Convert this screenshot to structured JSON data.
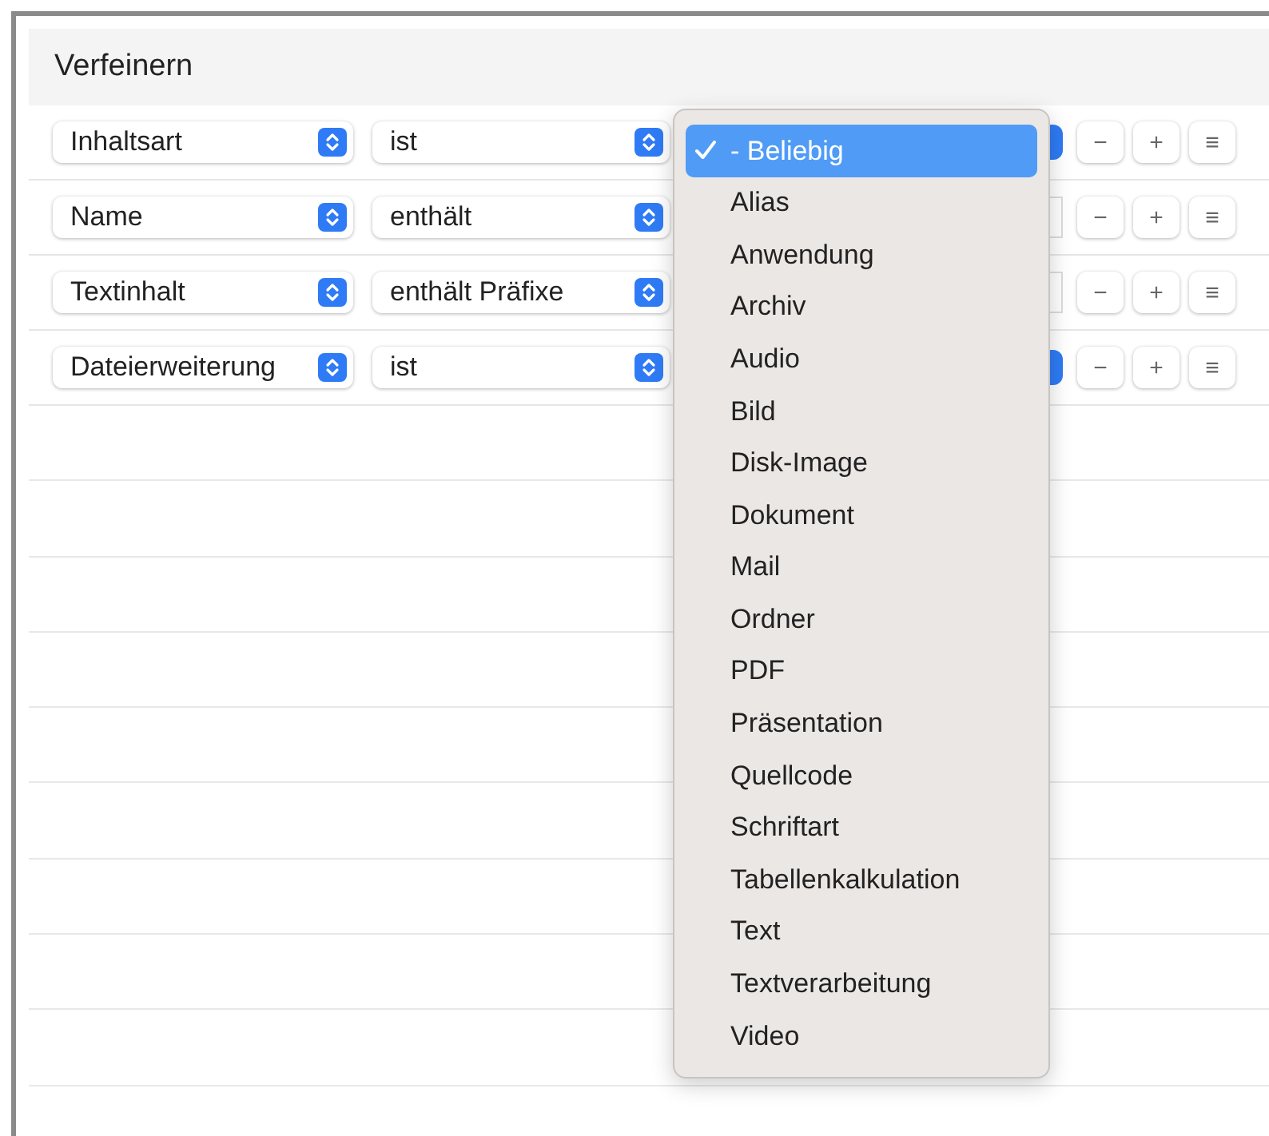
{
  "title": "Verfeinern",
  "rows": [
    {
      "attribute": "Inhaltsart",
      "operator": "ist",
      "kind": "popup"
    },
    {
      "attribute": "Name",
      "operator": "enthält",
      "kind": "field"
    },
    {
      "attribute": "Textinhalt",
      "operator": "enthält Präfixe",
      "kind": "field"
    },
    {
      "attribute": "Dateierweiterung",
      "operator": "ist",
      "kind": "popup"
    }
  ],
  "row_buttons": [
    "−",
    "+",
    "≡"
  ],
  "menu": [
    {
      "label": "- Beliebig",
      "selected": true
    },
    {
      "label": "Alias",
      "selected": false
    },
    {
      "label": "Anwendung",
      "selected": false
    },
    {
      "label": "Archiv",
      "selected": false
    },
    {
      "label": "Audio",
      "selected": false
    },
    {
      "label": "Bild",
      "selected": false
    },
    {
      "label": "Disk-Image",
      "selected": false
    },
    {
      "label": "Dokument",
      "selected": false
    },
    {
      "label": "Mail",
      "selected": false
    },
    {
      "label": "Ordner",
      "selected": false
    },
    {
      "label": "PDF",
      "selected": false
    },
    {
      "label": "Präsentation",
      "selected": false
    },
    {
      "label": "Quellcode",
      "selected": false
    },
    {
      "label": "Schriftart",
      "selected": false
    },
    {
      "label": "Tabellenkalkulation",
      "selected": false
    },
    {
      "label": "Text",
      "selected": false
    },
    {
      "label": "Textverarbeitung",
      "selected": false
    },
    {
      "label": "Video",
      "selected": false
    }
  ]
}
